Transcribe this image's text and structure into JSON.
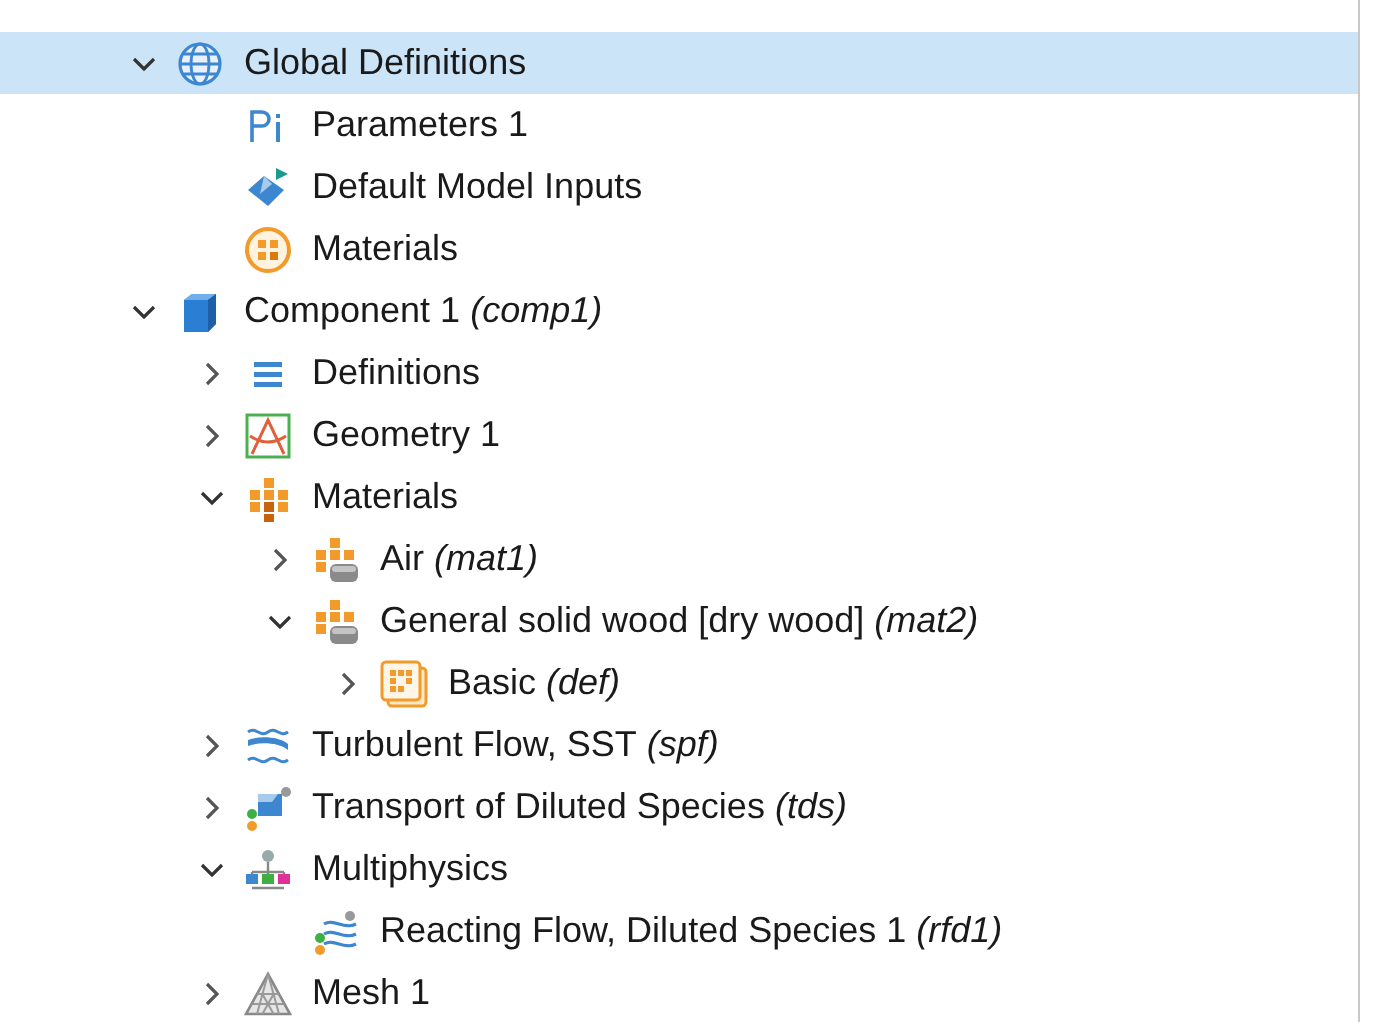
{
  "tree": [
    {
      "label": "Global Definitions",
      "kind": "globe",
      "expanded": true,
      "selected": true,
      "children": [
        {
          "label": "Parameters 1",
          "kind": "parameters",
          "selected": false
        },
        {
          "label": "Default Model Inputs",
          "kind": "inputs",
          "selected": false
        },
        {
          "label": "Materials",
          "kind": "materials-round",
          "selected": false
        }
      ]
    },
    {
      "label": "Component 1",
      "tag": "(comp1)",
      "kind": "cube",
      "expanded": true,
      "selected": false,
      "children": [
        {
          "label": "Definitions",
          "kind": "definitions",
          "expanded": false,
          "selected": false
        },
        {
          "label": "Geometry 1",
          "kind": "geometry",
          "expanded": false,
          "selected": false
        },
        {
          "label": "Materials",
          "kind": "materials",
          "expanded": true,
          "selected": false,
          "children": [
            {
              "label": "Air",
              "tag": "(mat1)",
              "kind": "material",
              "expanded": false,
              "selected": false
            },
            {
              "label": "General solid wood [dry wood]",
              "tag": "(mat2)",
              "kind": "material",
              "expanded": true,
              "selected": false,
              "children": [
                {
                  "label": "Basic",
                  "tag": "(def)",
                  "kind": "basic",
                  "expanded": false,
                  "selected": false
                }
              ]
            }
          ]
        },
        {
          "label": "Turbulent Flow, SST",
          "tag": "(spf)",
          "kind": "flow",
          "expanded": false,
          "selected": false
        },
        {
          "label": "Transport of Diluted Species",
          "tag": "(tds)",
          "kind": "transport",
          "expanded": false,
          "selected": false
        },
        {
          "label": "Multiphysics",
          "kind": "multiphysics",
          "expanded": true,
          "selected": false,
          "children": [
            {
              "label": "Reacting Flow, Diluted Species 1",
              "tag": "(rfd1)",
              "kind": "reacting",
              "selected": false
            }
          ]
        },
        {
          "label": "Mesh 1",
          "kind": "mesh",
          "expanded": false,
          "selected": false
        }
      ]
    }
  ]
}
